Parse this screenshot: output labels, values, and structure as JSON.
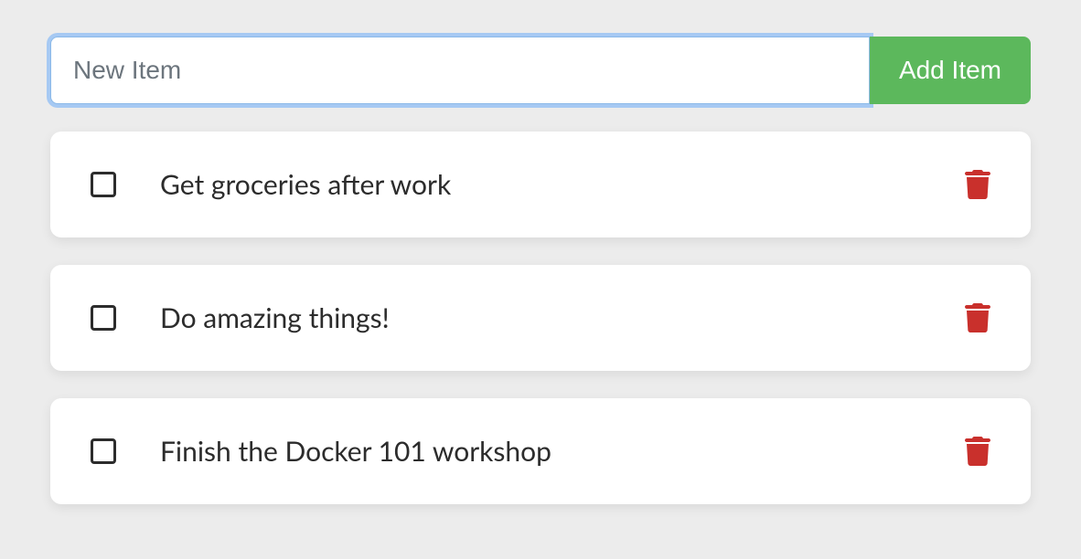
{
  "input": {
    "placeholder": "New Item",
    "value": ""
  },
  "add_button_label": "Add Item",
  "items": [
    {
      "text": "Get groceries after work",
      "checked": false
    },
    {
      "text": "Do amazing things!",
      "checked": false
    },
    {
      "text": "Finish the Docker 101 workshop",
      "checked": false
    }
  ],
  "colors": {
    "accent_green": "#5cb85c",
    "danger_red": "#c9302c",
    "focus_blue": "#8bb9e8",
    "background": "#ececec"
  }
}
